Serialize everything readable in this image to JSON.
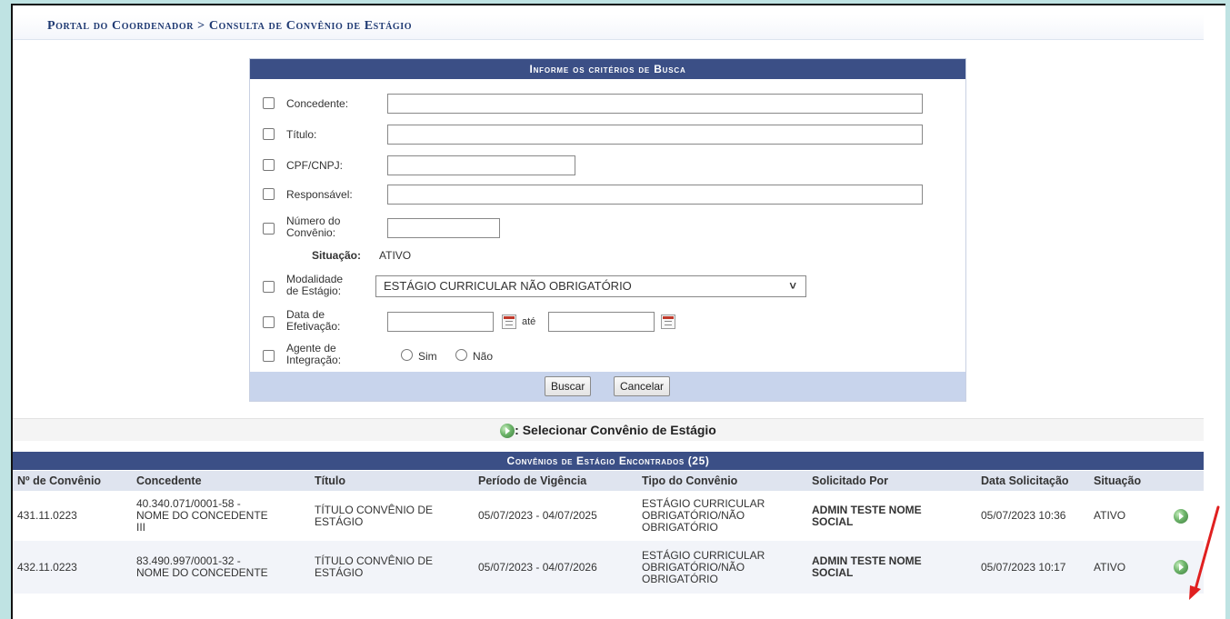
{
  "breadcrumb": "Portal do Coordenador > Consulta de Convênio de Estágio",
  "search": {
    "caption": "Informe os critérios de Busca",
    "concedente_label": "Concedente:",
    "titulo_label": "Título:",
    "cpf_label": "CPF/CNPJ:",
    "responsavel_label": "Responsável:",
    "numero_label_1": "Número do",
    "numero_label_2": "Convênio:",
    "situacao_label": "Situação:",
    "situacao_value": "ATIVO",
    "modalidade_label_1": "Modalidade",
    "modalidade_label_2": "de Estágio:",
    "modalidade_value": "ESTÁGIO CURRICULAR NÃO OBRIGATÓRIO",
    "data_label_1": "Data de",
    "data_label_2": "Efetivação:",
    "ate_label": "até",
    "agente_label_1": "Agente de",
    "agente_label_2": "Integração:",
    "sim_label": "Sim",
    "nao_label": "Não",
    "buscar_button": "Buscar",
    "cancelar_button": "Cancelar"
  },
  "legend": {
    "text": ": Selecionar Convênio de Estágio",
    "icon": "select-go-icon"
  },
  "table": {
    "caption": "Convênios de Estágio Encontrados (25)",
    "headers": [
      "Nº de Convênio",
      "Concedente",
      "Título",
      "Período de Vigência",
      "Tipo do Convênio",
      "Solicitado Por",
      "Data Solicitação",
      "Situação"
    ],
    "rows": [
      {
        "numero": "431.11.0223",
        "concedente_1": "40.340.071/0001-58 -",
        "concedente_2": "NOME DO CONCEDENTE",
        "concedente_3": "III",
        "titulo_1": "TÍTULO CONVÊNIO DE",
        "titulo_2": "ESTÁGIO",
        "periodo": "05/07/2023 - 04/07/2025",
        "tipo_1": "ESTÁGIO CURRICULAR",
        "tipo_2": "OBRIGATÓRIO/NÃO",
        "tipo_3": "OBRIGATÓRIO",
        "solicitado_1": "ADMIN TESTE NOME",
        "solicitado_2": "SOCIAL",
        "data": "05/07/2023 10:36",
        "situacao": "ATIVO"
      },
      {
        "numero": "432.11.0223",
        "concedente_1": "83.490.997/0001-32 -",
        "concedente_2": "NOME DO CONCEDENTE",
        "concedente_3": "",
        "titulo_1": "TÍTULO CONVÊNIO DE",
        "titulo_2": "ESTÁGIO",
        "periodo": "05/07/2023 - 04/07/2026",
        "tipo_1": "ESTÁGIO CURRICULAR",
        "tipo_2": "OBRIGATÓRIO/NÃO",
        "tipo_3": "OBRIGATÓRIO",
        "solicitado_1": "ADMIN TESTE NOME",
        "solicitado_2": "SOCIAL",
        "data": "05/07/2023 10:17",
        "situacao": "ATIVO"
      }
    ]
  },
  "colors": {
    "header_blue": "#3b4f86",
    "link_blue": "#1f3a8a",
    "annotation_red": "#e02020"
  }
}
